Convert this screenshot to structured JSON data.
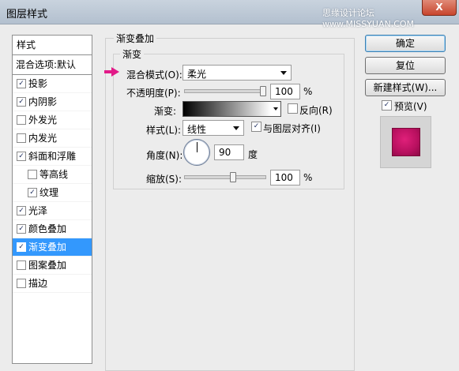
{
  "window": {
    "title": "图层样式",
    "watermark": "思缘设计论坛 www.MISSYUAN.COM",
    "close_glyph": "X"
  },
  "sidebar": {
    "header": "样式",
    "blend_label": "混合选项:默认",
    "items": [
      {
        "label": "投影",
        "checked": true
      },
      {
        "label": "内阴影",
        "checked": true
      },
      {
        "label": "外发光",
        "checked": false
      },
      {
        "label": "内发光",
        "checked": false
      },
      {
        "label": "斜面和浮雕",
        "checked": true
      },
      {
        "label": "等高线",
        "checked": false
      },
      {
        "label": "纹理",
        "checked": true
      },
      {
        "label": "光泽",
        "checked": true
      },
      {
        "label": "颜色叠加",
        "checked": true
      },
      {
        "label": "渐变叠加",
        "checked": true
      },
      {
        "label": "图案叠加",
        "checked": false
      },
      {
        "label": "描边",
        "checked": false
      }
    ]
  },
  "panel": {
    "outer_title": "渐变叠加",
    "inner_title": "渐变",
    "blend_mode_label": "混合模式(O):",
    "blend_mode_value": "柔光",
    "opacity_label": "不透明度(P):",
    "opacity_value": "100",
    "opacity_unit": "%",
    "gradient_label": "渐变:",
    "reverse_label": "反向(R)",
    "style_label": "样式(L):",
    "style_value": "线性",
    "align_label": "与图层对齐(I)",
    "angle_label": "角度(N):",
    "angle_value": "90",
    "angle_unit": "度",
    "scale_label": "缩放(S):",
    "scale_value": "100",
    "scale_unit": "%",
    "opacity_level": 1.0,
    "scale_level": 0.6
  },
  "buttons": {
    "ok": "确定",
    "reset": "复位",
    "new_style": "新建样式(W)...",
    "preview_label": "预览(V)"
  },
  "colors": {
    "accent_selected": "#3398fd",
    "arrow_pink": "#e21a88",
    "preview_swatch": "#c8156a"
  },
  "icons": {
    "check": "✓"
  }
}
